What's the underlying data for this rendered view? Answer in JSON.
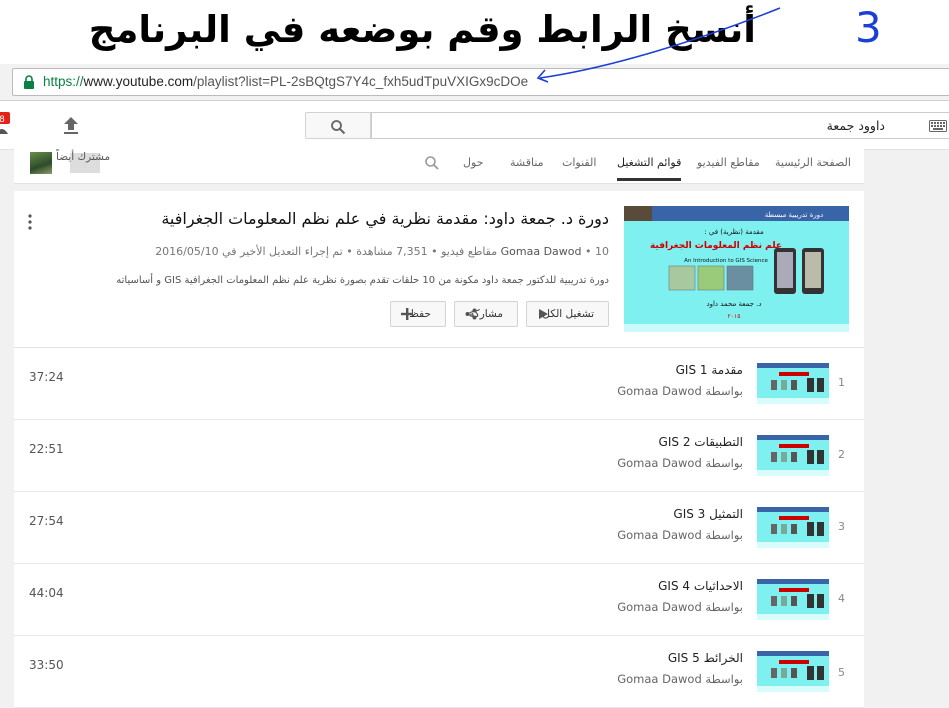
{
  "banner": {
    "instruction": "أنسخ الرابط وقم بوضعه في  البرنامج"
  },
  "address_bar": {
    "scheme": "https://",
    "host": "www.youtube.com",
    "path": "/playlist?list=PL-2sBQtgS7Y4c_fxh5udTpuVXIGx9cDOe"
  },
  "masthead": {
    "search_value": "داوود جمعة",
    "notification_badge": "8"
  },
  "channel_nav": {
    "subscribed_label": "مشترك أيضاً",
    "tabs": [
      {
        "label": "الصفحة الرئيسية",
        "active": false
      },
      {
        "label": "مقاطع الفيديو",
        "active": false
      },
      {
        "label": "قوائم التشغيل",
        "active": true
      },
      {
        "label": "القنوات",
        "active": false
      },
      {
        "label": "مناقشة",
        "active": false
      },
      {
        "label": "حول",
        "active": false
      }
    ]
  },
  "playlist": {
    "title": "دورة د. جمعة داود: مقدمة نظرية في علم نظم المعلومات الجغرافية",
    "owner": "Gomaa Dawod",
    "meta_rest": " • 10 مقاطع فيديو • 7,351 مشاهدة • تم إجراء التعديل الأخير في 2016/05/10",
    "description": "دورة تدريبية للدكتور جمعة داود مكونة من 10 حلقات تقدم بصورة نظرية علم نظم المعلومات الجغرافية GIS و أساسياته",
    "buttons": {
      "play_all": "تشغيل الكل",
      "share": "مشاركة",
      "save": "حفظ"
    },
    "thumbnail": {
      "header": "دورة تدريبية مبسطة",
      "line1": "مقدمة (نظرية) في :",
      "line2": "علم نظم المعلومات الجغرافية",
      "line3": "An Introduction to GIS Science",
      "author": "د. جمعة محمد داود",
      "footer": "٢٠١٥"
    }
  },
  "videos": [
    {
      "index": "1",
      "title": "مقدمة GIS 1",
      "by": "بواسطة Gomaa Dawod",
      "duration": "37:24"
    },
    {
      "index": "2",
      "title": "التطبيقات GIS 2",
      "by": "بواسطة Gomaa Dawod",
      "duration": "22:51"
    },
    {
      "index": "3",
      "title": "التمثيل GIS 3",
      "by": "بواسطة Gomaa Dawod",
      "duration": "27:54"
    },
    {
      "index": "4",
      "title": "الاحداثيات GIS 4",
      "by": "بواسطة Gomaa Dawod",
      "duration": "44:04"
    },
    {
      "index": "5",
      "title": "الخرائط GIS 5",
      "by": "بواسطة Gomaa Dawod",
      "duration": "33:50"
    }
  ],
  "colors": {
    "accent_red": "#e62117",
    "secure_green": "#0b8043",
    "thumb_cyan": "#7ff0f0",
    "annotation_blue": "#1a3fd6"
  },
  "annotations": {
    "step_number": "3"
  }
}
